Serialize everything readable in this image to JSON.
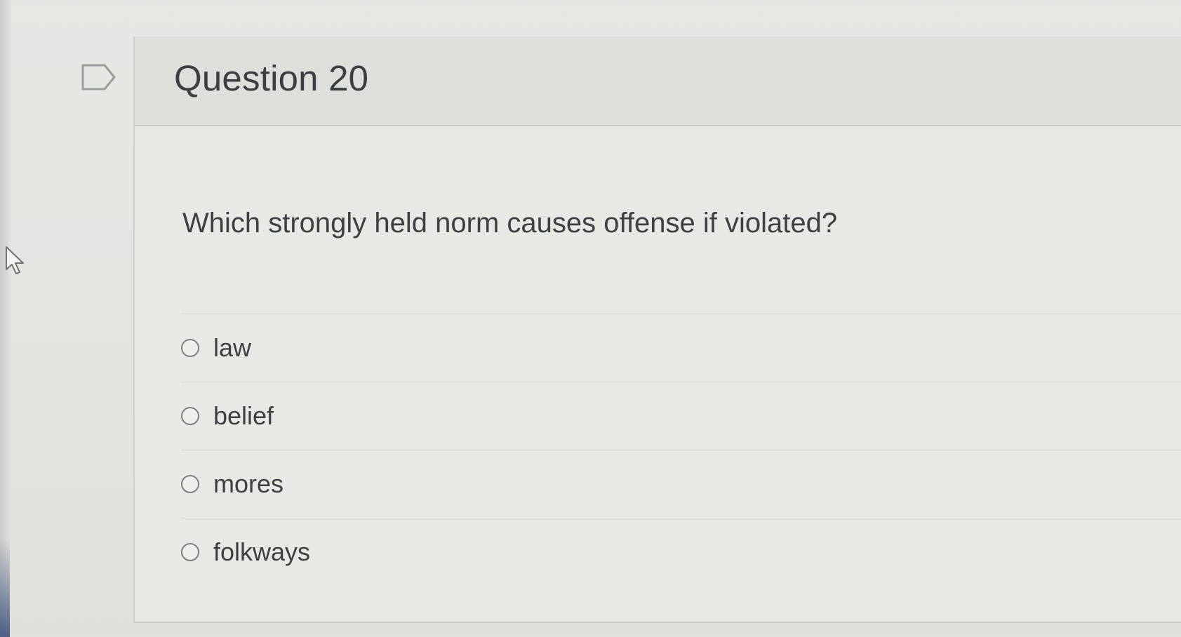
{
  "question": {
    "title": "Question 20",
    "text": "Which strongly held norm causes offense if violated?",
    "flag_icon": "flag-outline-icon",
    "answers": [
      {
        "label": "law",
        "selected": false
      },
      {
        "label": "belief",
        "selected": false
      },
      {
        "label": "mores",
        "selected": false
      },
      {
        "label": "folkways",
        "selected": false
      }
    ]
  },
  "cursor": {
    "icon": "pointer-cursor-icon"
  },
  "colors": {
    "page_background": "#e5e6e2",
    "header_background": "#dedfdb",
    "text": "#3b3e42",
    "radio_border": "#7d8084"
  }
}
